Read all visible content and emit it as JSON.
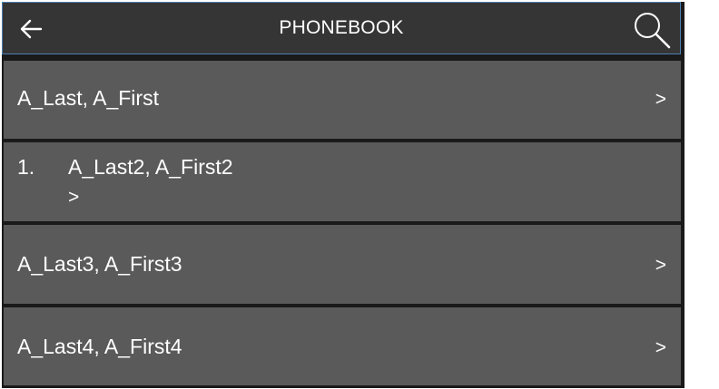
{
  "header": {
    "title": "PHONEBOOK",
    "back_icon": "arrow-left-icon",
    "search_icon": "magnifier-icon"
  },
  "contacts": [
    {
      "name": "A_Last, A_First",
      "chevron": ">"
    },
    {
      "index": "1.",
      "name": "A_Last2, A_First2",
      "chevron": ">"
    },
    {
      "name": "A_Last3, A_First3",
      "chevron": ">"
    },
    {
      "name": "A_Last4, A_First4",
      "chevron": ">"
    }
  ],
  "colors": {
    "header_bg": "#353535",
    "header_border": "#4c7fb0",
    "row_bg": "#5a5a5a",
    "separator": "#1a1a1a",
    "text": "#ffffff"
  }
}
